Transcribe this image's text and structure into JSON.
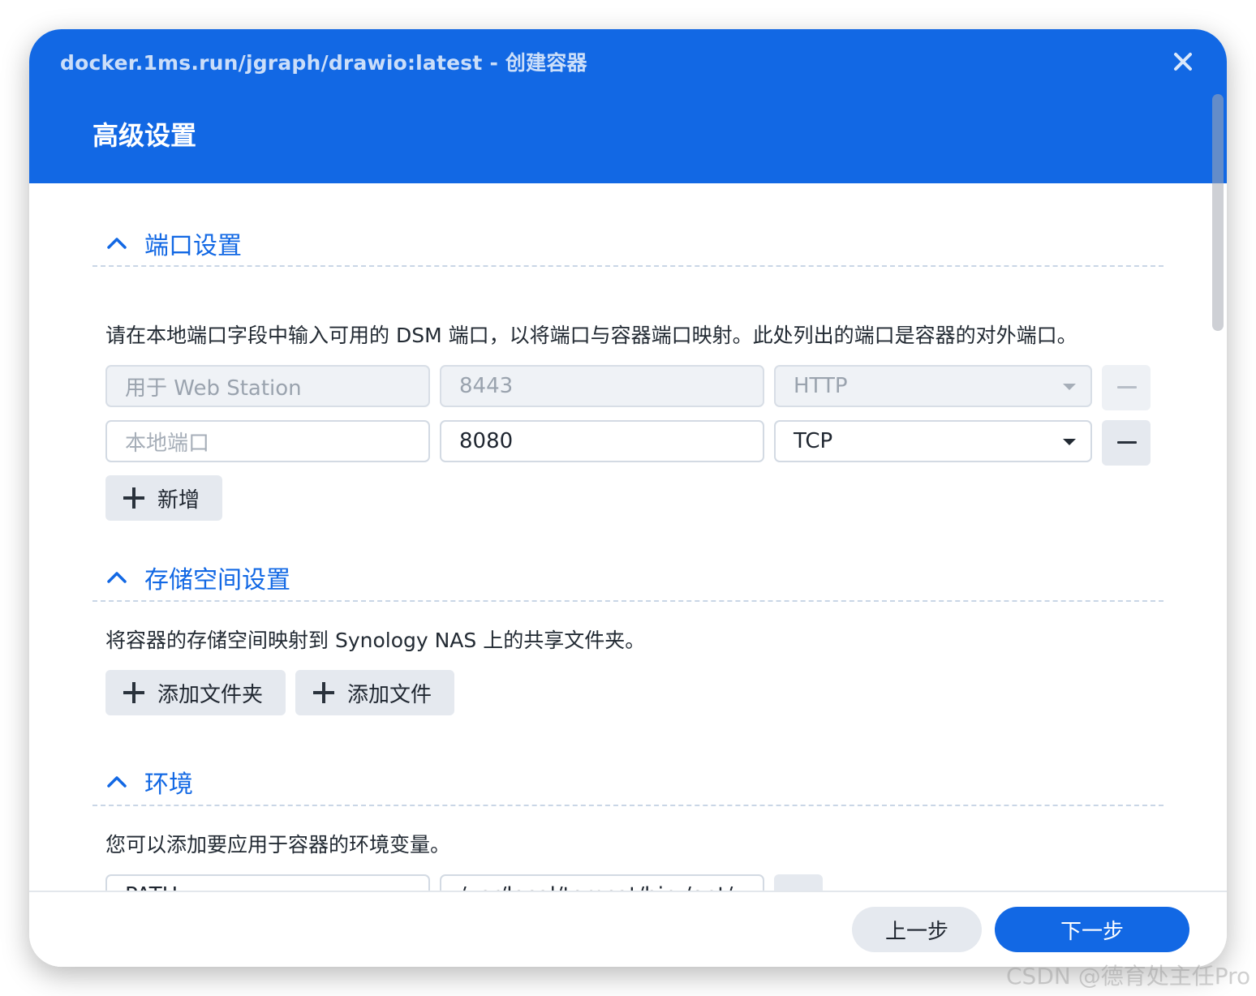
{
  "window": {
    "title": "docker.1ms.run/jgraph/drawio:latest - 创建容器",
    "close_icon": "close-icon"
  },
  "page": {
    "title": "高级设置"
  },
  "port_section": {
    "title": "端口设置",
    "description": "请在本地端口字段中输入可用的 DSM 端口，以将端口与容器端口映射。此处列出的端口是容器的对外端口。",
    "rows": [
      {
        "local_port": "用于 Web Station",
        "container_port": "8443",
        "protocol": "HTTP",
        "disabled": true
      },
      {
        "local_port_placeholder": "本地端口",
        "container_port": "8080",
        "protocol": "TCP",
        "disabled": false
      }
    ],
    "add_label": "新增"
  },
  "storage_section": {
    "title": "存储空间设置",
    "description": "将容器的存储空间映射到 Synology NAS 上的共享文件夹。",
    "add_folder_label": "添加文件夹",
    "add_file_label": "添加文件"
  },
  "env_section": {
    "title": "环境",
    "description": "您可以添加要应用于容器的环境变量。",
    "rows": [
      {
        "key": "PATH",
        "value": "/usr/local/tomcat/bin:/opt/"
      }
    ]
  },
  "footer": {
    "prev_label": "上一步",
    "next_label": "下一步"
  },
  "watermark": "CSDN @德育处主任Pro",
  "colors": {
    "accent": "#1268e4",
    "button_bg": "#e5e9ef",
    "disabled_bg": "#eff2f6"
  }
}
